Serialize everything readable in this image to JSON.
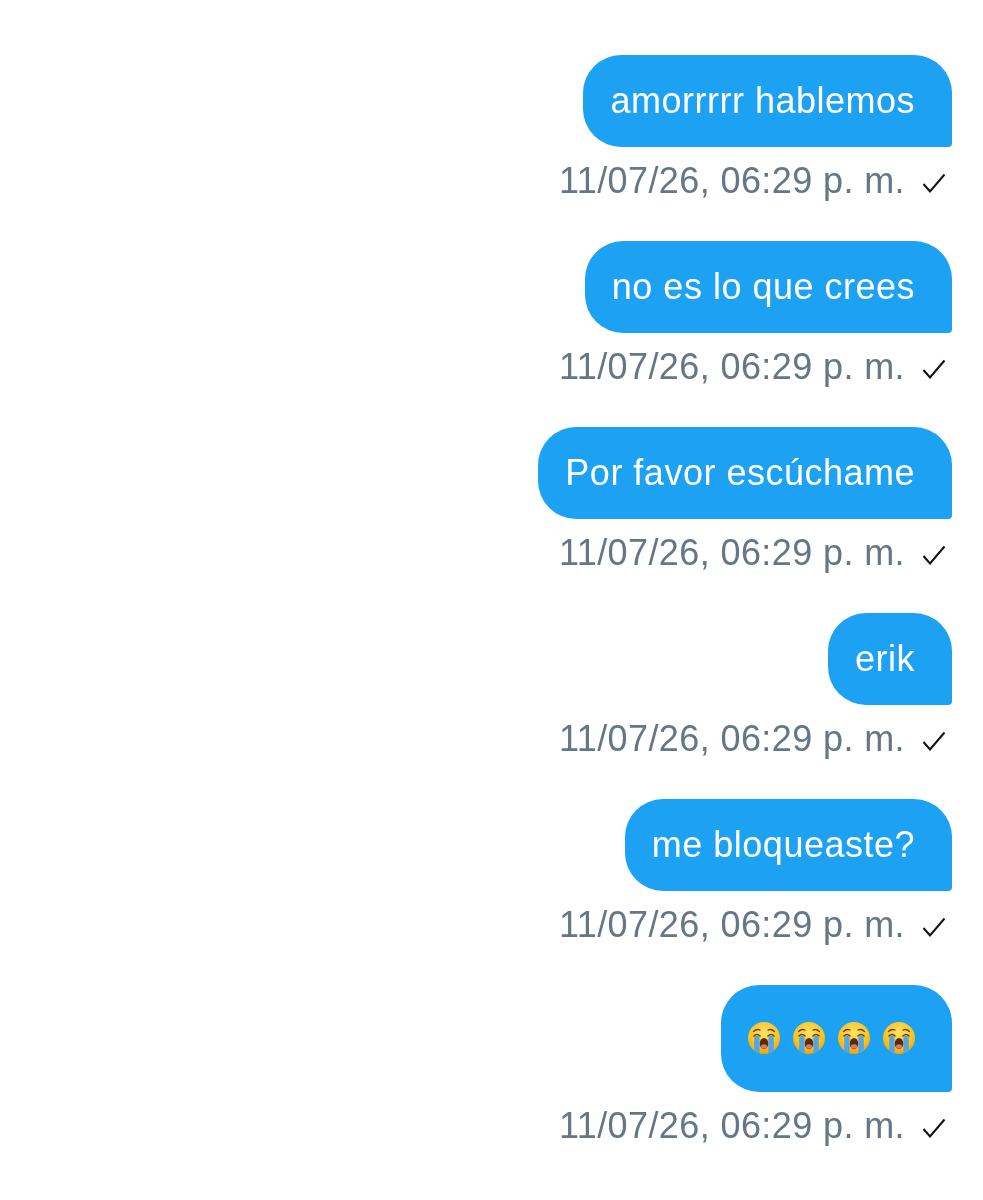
{
  "messages": [
    {
      "kind": "text",
      "text": "amorrrrr hablemos",
      "time": "11/07/26, 06:29 p. m.",
      "sent": true
    },
    {
      "kind": "text",
      "text": "no es lo que crees",
      "time": "11/07/26, 06:29 p. m.",
      "sent": true
    },
    {
      "kind": "text",
      "text": "Por favor escúchame",
      "time": "11/07/26, 06:29 p. m.",
      "sent": true
    },
    {
      "kind": "text",
      "text": "erik",
      "time": "11/07/26, 06:29 p. m.",
      "sent": true
    },
    {
      "kind": "text",
      "text": "me bloqueaste?",
      "time": "11/07/26, 06:29 p. m.",
      "sent": true
    },
    {
      "kind": "emoji",
      "emojis": [
        {
          "kind": "loudly-crying"
        },
        {
          "kind": "loudly-crying"
        },
        {
          "kind": "loudly-crying"
        },
        {
          "kind": "loudly-crying"
        }
      ],
      "time": "11/07/26, 06:29 p. m.",
      "sent": true
    }
  ]
}
